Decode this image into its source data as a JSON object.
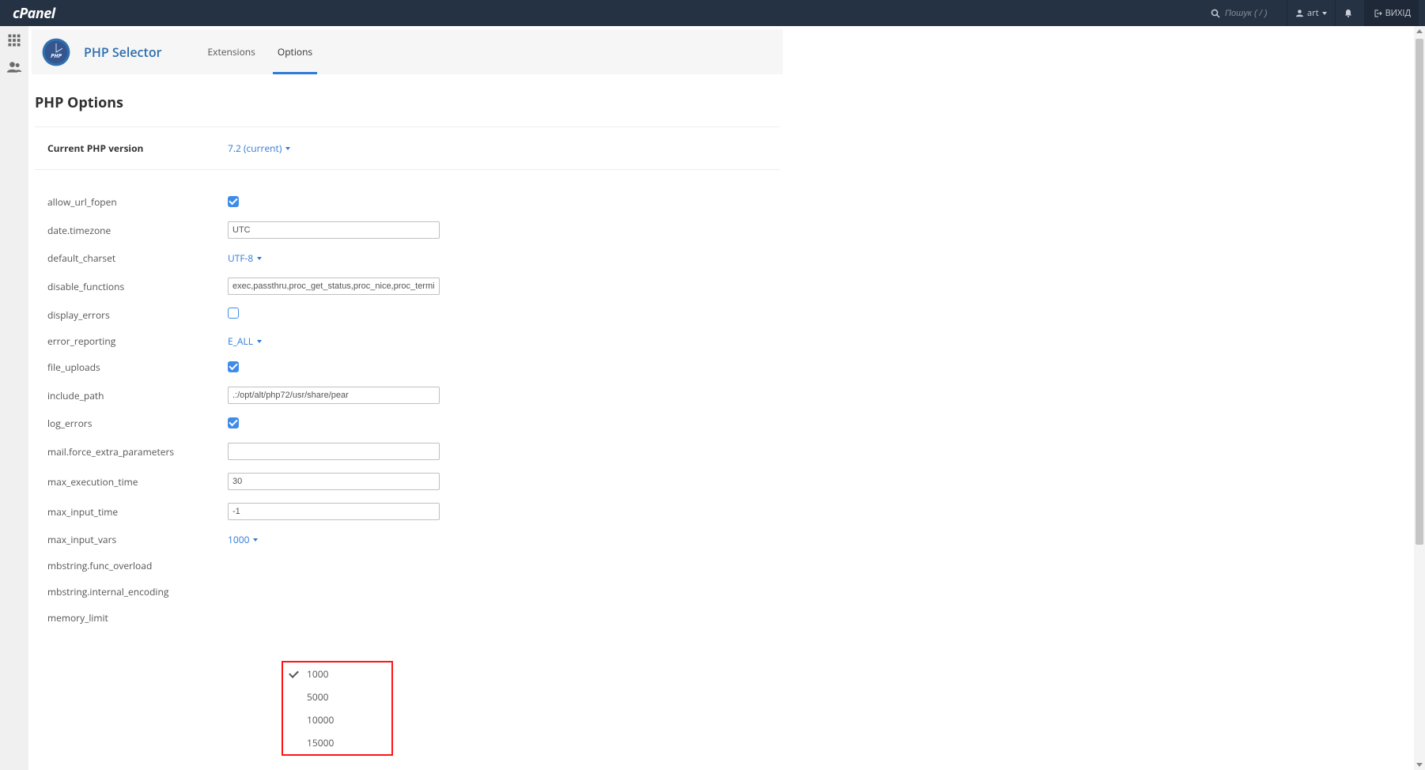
{
  "header": {
    "brand": "cPanel",
    "search_placeholder": "Пошук ( / )",
    "user_label": "art",
    "logout_label": "ВИХІД"
  },
  "page": {
    "title": "PHP Selector",
    "tabs": {
      "extensions": "Extensions",
      "options": "Options"
    },
    "section_heading": "PHP Options",
    "version_label": "Current PHP version",
    "version_value": "7.2 (current)"
  },
  "options": {
    "allow_url_fopen": {
      "label": "allow_url_fopen"
    },
    "date_timezone": {
      "label": "date.timezone",
      "value": "UTC"
    },
    "default_charset": {
      "label": "default_charset",
      "value": "UTF-8"
    },
    "disable_functions": {
      "label": "disable_functions",
      "value": "exec,passthru,proc_get_status,proc_nice,proc_terminate,shell_ex"
    },
    "display_errors": {
      "label": "display_errors"
    },
    "error_reporting": {
      "label": "error_reporting",
      "value": "E_ALL"
    },
    "file_uploads": {
      "label": "file_uploads"
    },
    "include_path": {
      "label": "include_path",
      "value": ".:/opt/alt/php72/usr/share/pear"
    },
    "log_errors": {
      "label": "log_errors"
    },
    "mail_force_extra_parameters": {
      "label": "mail.force_extra_parameters",
      "value": ""
    },
    "max_execution_time": {
      "label": "max_execution_time",
      "value": "30"
    },
    "max_input_time": {
      "label": "max_input_time",
      "value": "-1"
    },
    "max_input_vars": {
      "label": "max_input_vars",
      "value": "1000",
      "options": [
        "1000",
        "5000",
        "10000",
        "15000"
      ]
    },
    "mbstring_func_overload": {
      "label": "mbstring.func_overload"
    },
    "mbstring_internal_encoding": {
      "label": "mbstring.internal_encoding"
    },
    "memory_limit": {
      "label": "memory_limit"
    }
  }
}
